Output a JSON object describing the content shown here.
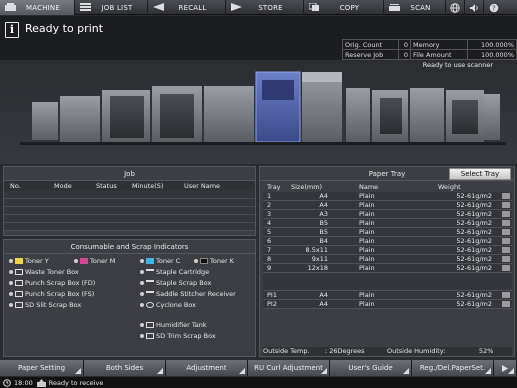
{
  "tabs": [
    {
      "label": "MACHINE",
      "icon": "machine-icon",
      "active": true
    },
    {
      "label": "JOB LIST",
      "icon": "list-icon",
      "active": false
    },
    {
      "label": "RECALL",
      "icon": "recall-icon",
      "active": false
    },
    {
      "label": "STORE",
      "icon": "store-icon",
      "active": false
    },
    {
      "label": "COPY",
      "icon": "copy-icon",
      "active": false
    },
    {
      "label": "SCAN",
      "icon": "scan-icon",
      "active": false
    }
  ],
  "tab_icons": [
    "globe-icon",
    "volume-icon",
    "help-icon"
  ],
  "header": {
    "status": "Ready to print",
    "orig_count_label": "Orig. Count",
    "orig_count": "0",
    "memory_label": "Memory",
    "memory": "100.000%",
    "reserve_job_label": "Reserve Job",
    "reserve_job": "0",
    "file_amount_label": "File Amount",
    "file_amount": "100.000%",
    "scanner_status": "Ready to use scanner"
  },
  "job": {
    "title": "Job",
    "columns": [
      "No.",
      "Mode",
      "Status",
      "Minute(S)",
      "User Name"
    ]
  },
  "consumables": {
    "title": "Consumable and Scrap Indicators",
    "left": [
      "Toner Y",
      "Toner M",
      "Waste Toner Box",
      "Punch Scrap Box (FD)",
      "Punch Scrap Box (FS)",
      "SD Slit Scrap Box"
    ],
    "right": [
      "Toner C",
      "Toner K",
      "Staple Cartridge",
      "Staple Scrap Box",
      "Saddle Stitcher Receiver",
      "Cyclone Box",
      "Humidifier Tank",
      "SD Trim Scrap Box"
    ]
  },
  "paper_tray": {
    "title": "Paper Tray",
    "select_label": "Select Tray",
    "columns": {
      "tray": "Tray",
      "size": "Size(mm)",
      "name": "Name",
      "weight": "Weight"
    },
    "rows": [
      {
        "tray": "1",
        "size": "A4",
        "name": "Plain",
        "weight": "52-61g/m2"
      },
      {
        "tray": "2",
        "size": "A4",
        "name": "Plain",
        "weight": "52-61g/m2"
      },
      {
        "tray": "3",
        "size": "A3",
        "name": "Plain",
        "weight": "52-61g/m2"
      },
      {
        "tray": "4",
        "size": "B5",
        "name": "Plain",
        "weight": "52-61g/m2"
      },
      {
        "tray": "5",
        "size": "B5",
        "name": "Plain",
        "weight": "52-61g/m2"
      },
      {
        "tray": "6",
        "size": "B4",
        "name": "Plain",
        "weight": "52-61g/m2"
      },
      {
        "tray": "7",
        "size": "8.5x11",
        "name": "Plain",
        "weight": "52-61g/m2"
      },
      {
        "tray": "8",
        "size": "9x11",
        "name": "Plain",
        "weight": "52-61g/m2"
      },
      {
        "tray": "9",
        "size": "12x18",
        "name": "Plain",
        "weight": "52-61g/m2"
      }
    ],
    "pi_rows": [
      {
        "tray": "PI1",
        "size": "A4",
        "name": "Plain",
        "weight": "52-61g/m2"
      },
      {
        "tray": "PI2",
        "size": "A4",
        "name": "Plain",
        "weight": "52-61g/m2"
      }
    ],
    "outside_temp_label": "Outside Temp.",
    "outside_temp": ": 26Degrees",
    "outside_humidity_label": "Outside Humidity:",
    "outside_humidity": "52%"
  },
  "bottom_buttons": [
    "Paper Setting",
    "Both Sides",
    "Adjustment",
    "RU Curl Adjustment",
    "User's Guide",
    "Reg./Del.PaperSet."
  ],
  "statusline": {
    "time": "18:00",
    "message": "Ready to receive"
  },
  "colors": {
    "accent": "#5a6fb8",
    "tab_active": "#6b6f76"
  }
}
